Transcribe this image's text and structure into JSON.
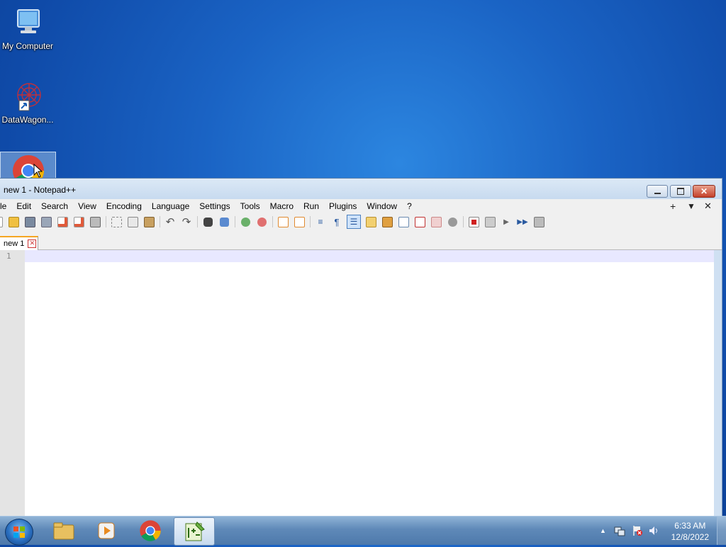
{
  "desktop": {
    "icons": [
      {
        "label": "My Computer"
      },
      {
        "label": "DataWagon..."
      },
      {
        "label": ""
      }
    ]
  },
  "window": {
    "title": "new 1 - Notepad++",
    "menu": [
      "File",
      "Edit",
      "Search",
      "View",
      "Encoding",
      "Language",
      "Settings",
      "Tools",
      "Macro",
      "Run",
      "Plugins",
      "Window",
      "?"
    ],
    "menu_right": {
      "plus": "+",
      "dropdown": "▼",
      "close": "✕"
    },
    "tab": {
      "label": "new 1",
      "close": "✕"
    },
    "editor": {
      "line_numbers": [
        "1"
      ]
    },
    "toolbar_icons": [
      "new-file-icon",
      "open-file-icon",
      "save-icon",
      "save-all-icon",
      "close-icon",
      "close-all-icon",
      "print-icon",
      "cut-icon",
      "copy-icon",
      "paste-icon",
      "undo-icon",
      "redo-icon",
      "find-icon",
      "replace-icon",
      "zoom-in-icon",
      "zoom-out-icon",
      "sync-vertical-icon",
      "sync-horizontal-icon",
      "word-wrap-icon",
      "show-all-characters-icon",
      "indent-guide-icon",
      "user-defined-language-icon",
      "document-map-icon",
      "function-list-icon",
      "folder-as-workspace-icon",
      "monitoring-icon",
      "record-macro-icon",
      "stop-recording-icon",
      "play-macro-icon",
      "run-macro-multiple-icon",
      "save-macro-icon"
    ]
  },
  "taskbar": {
    "clock_time": "6:33 AM",
    "clock_date": "12/8/2022",
    "tray_arrow": "▲"
  },
  "colors": {
    "desktop_blue": "#1a63c4",
    "current_line": "#e8e8ff",
    "tab_accent": "#f5a623",
    "close_red": "#c4402a"
  }
}
